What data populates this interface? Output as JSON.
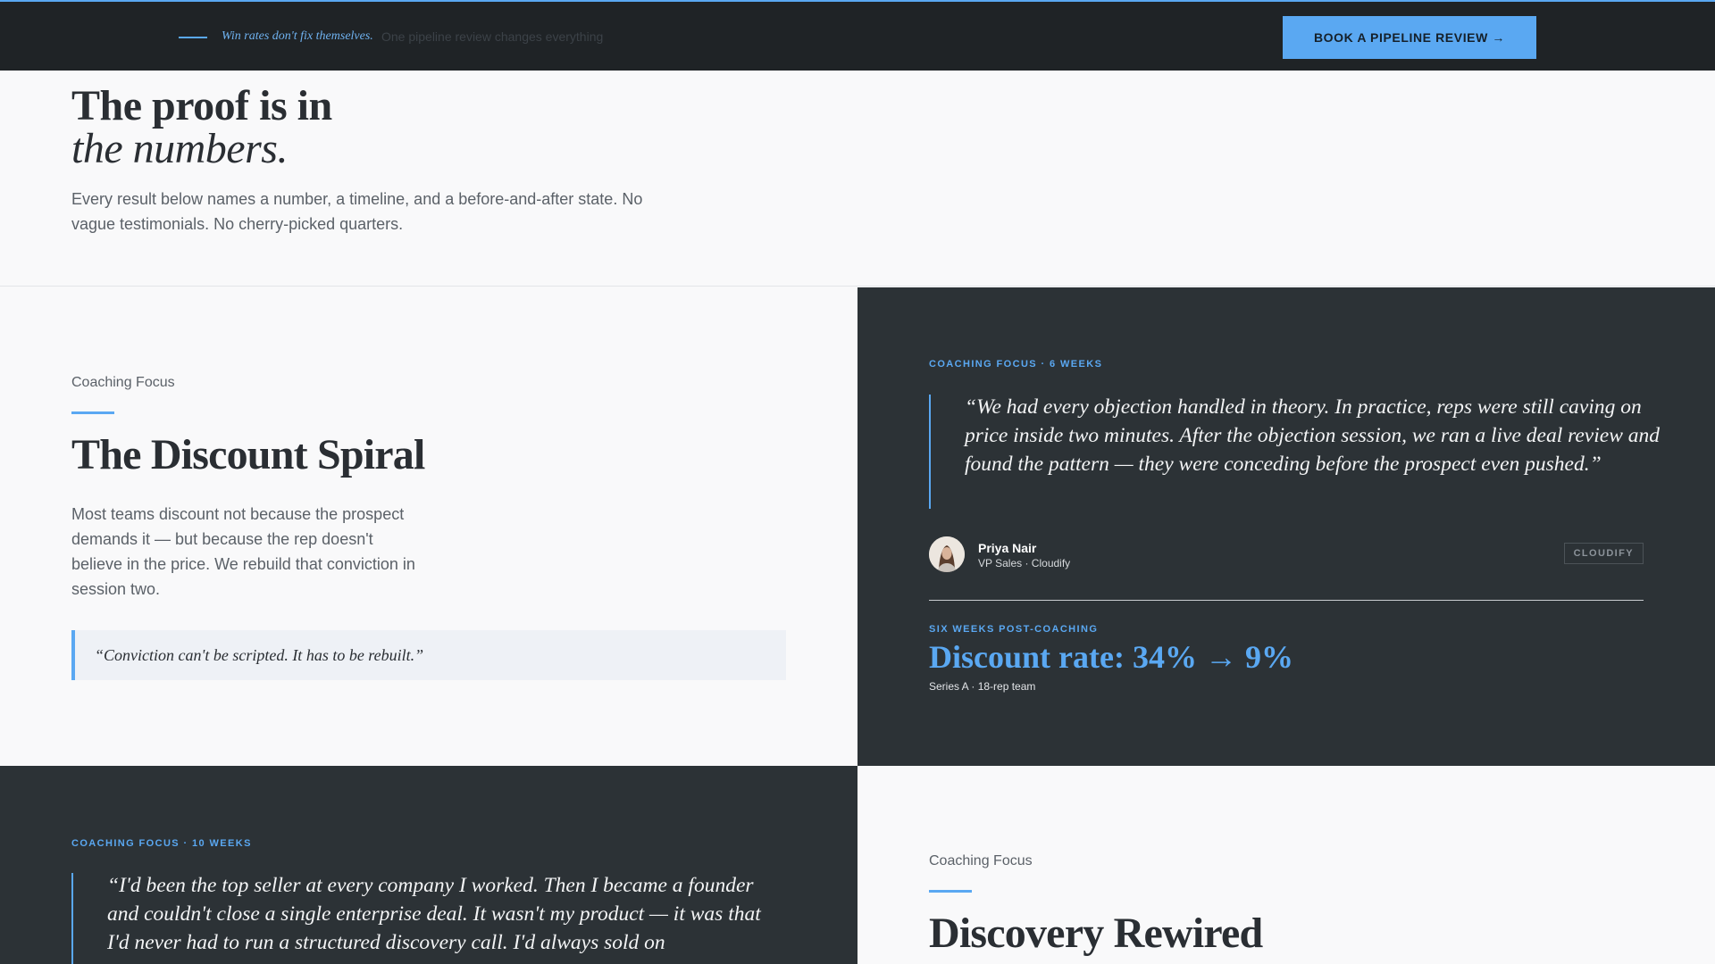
{
  "topbar": {
    "tagline": "Win rates don't fix themselves.",
    "tagline_muted": "One pipeline review changes everything",
    "cta_label": "BOOK A PIPELINE REVIEW →"
  },
  "intro": {
    "title_line1": "The proof is in",
    "title_line2": "the numbers.",
    "body": "Every result below names a number, a timeline, and a before-and-after state. No vague testimonials. No cherry-picked quarters."
  },
  "case1": {
    "kicker": "Coaching Focus",
    "title": "The Discount Spiral",
    "body": "Most teams discount not because the prospect demands it — but because the rep doesn't believe in the price. We rebuild that conviction in session two.",
    "pullquote": "“Conviction can't be scripted. It has to be rebuilt.”"
  },
  "testimonial1": {
    "label": "COACHING FOCUS · 6 WEEKS",
    "quote": "“We had every objection handled in theory. In practice, reps were still caving on price inside two minutes. After the objection session, we ran a live deal review and found the pattern — they were conceding before the prospect even pushed.”",
    "name": "Priya Nair",
    "role": "VP Sales · Cloudify",
    "company": "CLOUDIFY",
    "result_label": "SIX WEEKS POST-COACHING",
    "metric": "Discount rate: 34% → 9%",
    "metric_sub": "Series A · 18-rep team"
  },
  "testimonial2": {
    "label": "COACHING FOCUS · 10 WEEKS",
    "quote": "“I'd been the top seller at every company I worked. Then I became a founder and couldn't close a single enterprise deal. It wasn't my product — it was that I'd never had to run a structured discovery call. I'd always sold on"
  },
  "case2": {
    "kicker": "Coaching Focus",
    "title": "Discovery Rewired"
  }
}
